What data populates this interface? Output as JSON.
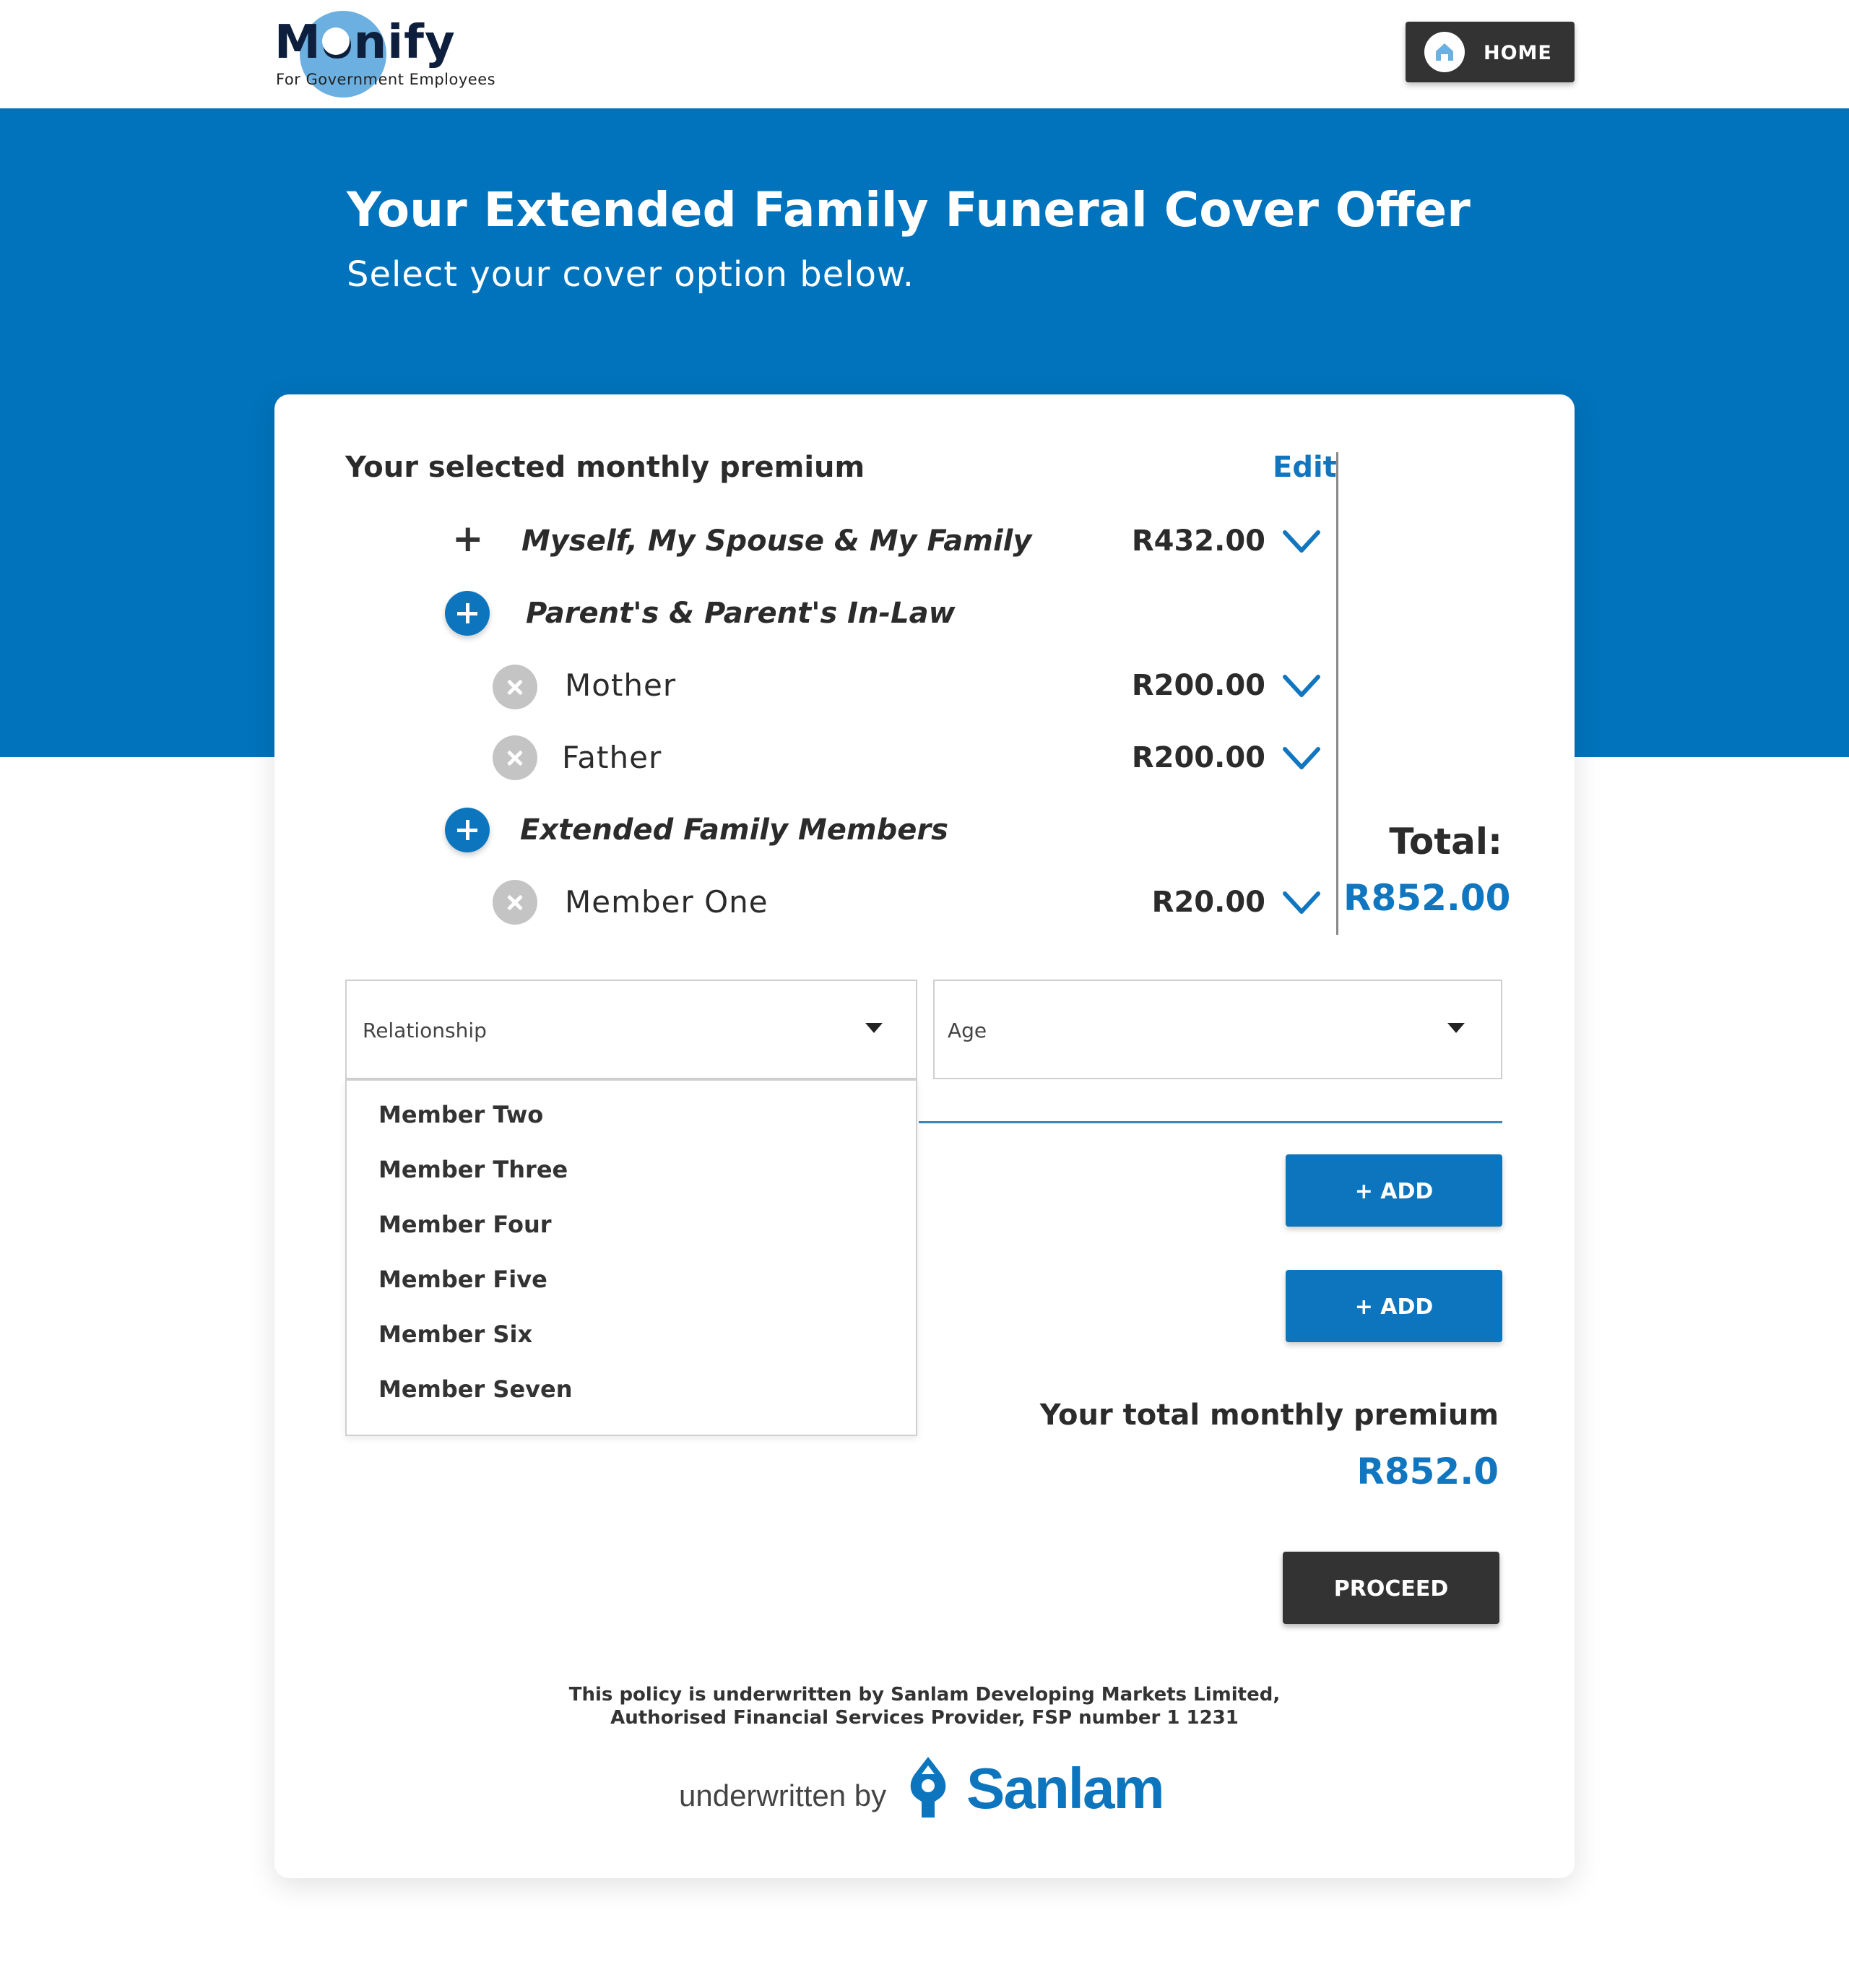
{
  "header": {
    "logo_text": "Monify",
    "logo_sub": "For Government Employees",
    "home_label": "HOME"
  },
  "hero": {
    "title": "Your Extended Family Funeral Cover Offer",
    "subtitle": "Select your cover option below."
  },
  "summary": {
    "title": "Your selected monthly premium",
    "edit_label": "Edit",
    "groups": [
      {
        "label": "Myself, My Spouse & My Family",
        "price": "R432.00"
      },
      {
        "label": "Parent's & Parent's In-Law",
        "members": [
          {
            "label": "Mother",
            "price": "R200.00"
          },
          {
            "label": "Father",
            "price": "R200.00"
          }
        ]
      },
      {
        "label": "Extended Family Members",
        "members": [
          {
            "label": "Member One",
            "price": "R20.00"
          }
        ]
      }
    ],
    "total_label": "Total:",
    "total_value": "R852.00"
  },
  "form": {
    "relationship_label": "Relationship",
    "age_label": "Age",
    "dropdown_options": [
      "Member Two",
      "Member Three",
      "Member Four",
      "Member Five",
      "Member Six",
      "Member Seven"
    ],
    "add_label_1": "+ ADD",
    "add_label_2": "+ ADD"
  },
  "premium": {
    "label": "Your total monthly premium",
    "value": "R852.0"
  },
  "proceed_label": "PROCEED",
  "footer": {
    "line1": "This policy is underwritten by Sanlam Developing Markets Limited,",
    "line2": "Authorised Financial Services Provider, FSP number 1 1231",
    "underwritten_by": "underwritten by",
    "brand": "Sanlam"
  },
  "colors": {
    "primary_blue": "#0073bc",
    "accent_blue": "#1176c0",
    "dark_button": "#333333"
  }
}
